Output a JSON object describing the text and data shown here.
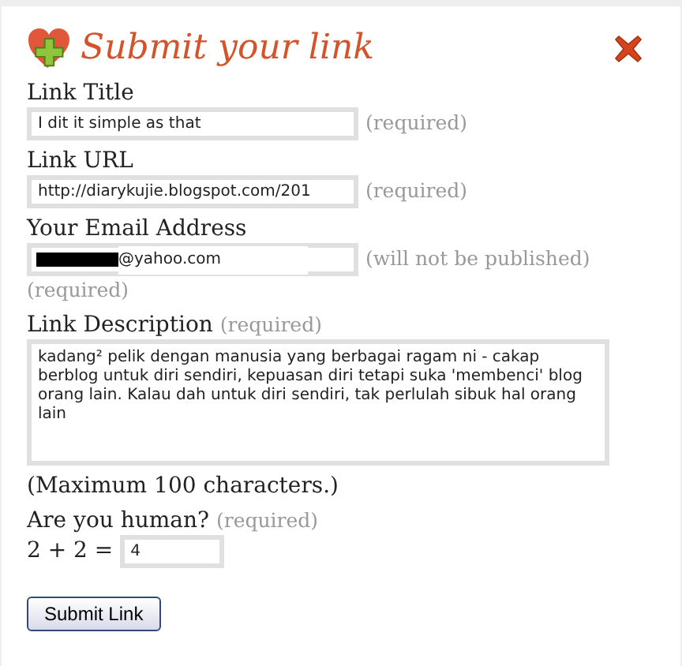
{
  "dialog": {
    "title": "Submit your link",
    "fields": [
      {
        "kind": "text",
        "label": "Link Title",
        "value": "I dit it simple as that",
        "notes": [
          "(required)"
        ]
      },
      {
        "kind": "text",
        "label": "Link URL",
        "value": "http://diarykujie.blogspot.com/201",
        "notes": [
          "(required)"
        ]
      },
      {
        "kind": "email",
        "label": "Your Email Address",
        "value": "@yahoo.com",
        "redacted": true,
        "notes": [
          "(will not be published)",
          "(required)"
        ]
      },
      {
        "kind": "textarea",
        "label": "Link Description",
        "label_note": "(required)",
        "value": "kadang² pelik dengan manusia yang berbagai ragam ni - cakap berblog untuk diri sendiri, kepuasan diri tetapi suka 'membenci' blog orang lain. Kalau dah untuk diri sendiri, tak perlulah sibuk hal orang lain",
        "hint": "(Maximum 100 characters.)"
      },
      {
        "kind": "captcha",
        "label": "Are you human?",
        "label_note": "(required)",
        "question": "2 + 2 =",
        "value": "4"
      }
    ],
    "submit": "Submit Link"
  }
}
